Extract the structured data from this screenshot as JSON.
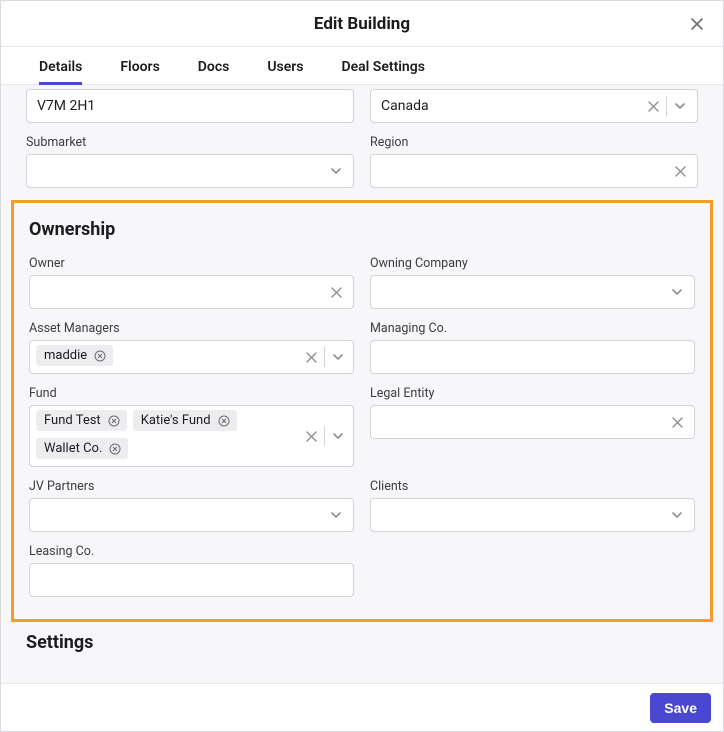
{
  "dialog": {
    "title": "Edit Building"
  },
  "tabs": [
    {
      "label": "Details",
      "active": true
    },
    {
      "label": "Floors",
      "active": false
    },
    {
      "label": "Docs",
      "active": false
    },
    {
      "label": "Users",
      "active": false
    },
    {
      "label": "Deal Settings",
      "active": false
    }
  ],
  "top_fields": {
    "postal": {
      "label": "",
      "value": "V7M 2H1"
    },
    "country": {
      "label": "",
      "value": "Canada"
    },
    "submarket": {
      "label": "Submarket",
      "value": ""
    },
    "region": {
      "label": "Region",
      "value": ""
    }
  },
  "ownership": {
    "title": "Ownership",
    "owner": {
      "label": "Owner",
      "value": ""
    },
    "owning_company": {
      "label": "Owning Company",
      "value": ""
    },
    "asset_managers": {
      "label": "Asset Managers",
      "chips": [
        "maddie"
      ]
    },
    "managing_co": {
      "label": "Managing Co.",
      "value": ""
    },
    "fund": {
      "label": "Fund",
      "chips": [
        "Fund Test",
        "Katie's Fund",
        "Wallet Co."
      ]
    },
    "legal_entity": {
      "label": "Legal Entity",
      "value": ""
    },
    "jv_partners": {
      "label": "JV Partners",
      "value": ""
    },
    "clients": {
      "label": "Clients",
      "value": ""
    },
    "leasing_co": {
      "label": "Leasing Co.",
      "value": ""
    }
  },
  "settings": {
    "title": "Settings"
  },
  "footer": {
    "save": "Save"
  }
}
